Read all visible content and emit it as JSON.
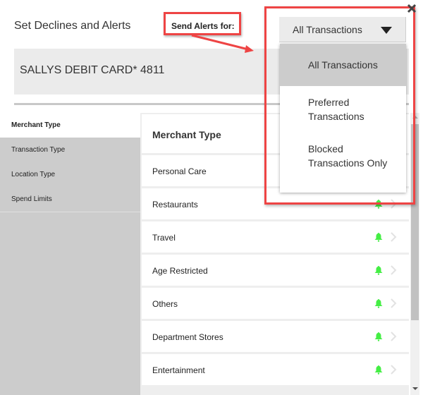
{
  "header": {
    "title": "Set Declines and Alerts",
    "send_alerts_label": "Send Alerts for:"
  },
  "card": {
    "name": "SALLYS DEBIT CARD* 4811"
  },
  "sidebar": {
    "items": [
      {
        "label": "Merchant Type",
        "active": true
      },
      {
        "label": "Transaction Type",
        "active": false
      },
      {
        "label": "Location Type",
        "active": false
      },
      {
        "label": "Spend Limits",
        "active": false
      }
    ]
  },
  "list": {
    "header": "Merchant Type",
    "rows": [
      {
        "label": "Personal Care",
        "alert": true
      },
      {
        "label": "Restaurants",
        "alert": true
      },
      {
        "label": "Travel",
        "alert": true
      },
      {
        "label": "Age Restricted",
        "alert": true
      },
      {
        "label": "Others",
        "alert": true
      },
      {
        "label": "Department Stores",
        "alert": true
      },
      {
        "label": "Entertainment",
        "alert": true
      }
    ]
  },
  "alerts_select": {
    "value": "All Transactions",
    "options": [
      {
        "label": "All Transactions",
        "selected": true
      },
      {
        "label": "Preferred Transactions",
        "selected": false
      },
      {
        "label": "Blocked Transactions Only",
        "selected": false
      }
    ]
  },
  "icons": {
    "close": "close-icon",
    "bell": "bell-icon",
    "chevron": "chevron-right-icon",
    "caret": "caret-down-icon"
  },
  "colors": {
    "annotation_red": "#ee4444",
    "bell_green": "#44ee44",
    "sidebar_gray": "#cccccc",
    "banner_gray": "#ebebeb"
  }
}
